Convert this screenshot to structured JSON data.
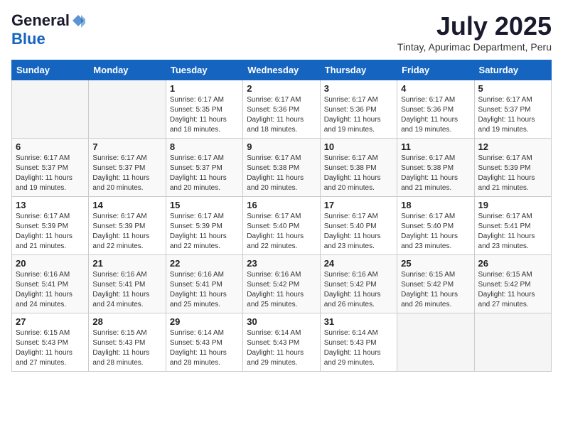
{
  "logo": {
    "general": "General",
    "blue": "Blue"
  },
  "header": {
    "month_year": "July 2025",
    "location": "Tintay, Apurimac Department, Peru"
  },
  "weekdays": [
    "Sunday",
    "Monday",
    "Tuesday",
    "Wednesday",
    "Thursday",
    "Friday",
    "Saturday"
  ],
  "weeks": [
    [
      {
        "day": "",
        "empty": true
      },
      {
        "day": "",
        "empty": true
      },
      {
        "day": "1",
        "sunrise": "Sunrise: 6:17 AM",
        "sunset": "Sunset: 5:35 PM",
        "daylight": "Daylight: 11 hours and 18 minutes."
      },
      {
        "day": "2",
        "sunrise": "Sunrise: 6:17 AM",
        "sunset": "Sunset: 5:36 PM",
        "daylight": "Daylight: 11 hours and 18 minutes."
      },
      {
        "day": "3",
        "sunrise": "Sunrise: 6:17 AM",
        "sunset": "Sunset: 5:36 PM",
        "daylight": "Daylight: 11 hours and 19 minutes."
      },
      {
        "day": "4",
        "sunrise": "Sunrise: 6:17 AM",
        "sunset": "Sunset: 5:36 PM",
        "daylight": "Daylight: 11 hours and 19 minutes."
      },
      {
        "day": "5",
        "sunrise": "Sunrise: 6:17 AM",
        "sunset": "Sunset: 5:37 PM",
        "daylight": "Daylight: 11 hours and 19 minutes."
      }
    ],
    [
      {
        "day": "6",
        "sunrise": "Sunrise: 6:17 AM",
        "sunset": "Sunset: 5:37 PM",
        "daylight": "Daylight: 11 hours and 19 minutes."
      },
      {
        "day": "7",
        "sunrise": "Sunrise: 6:17 AM",
        "sunset": "Sunset: 5:37 PM",
        "daylight": "Daylight: 11 hours and 20 minutes."
      },
      {
        "day": "8",
        "sunrise": "Sunrise: 6:17 AM",
        "sunset": "Sunset: 5:37 PM",
        "daylight": "Daylight: 11 hours and 20 minutes."
      },
      {
        "day": "9",
        "sunrise": "Sunrise: 6:17 AM",
        "sunset": "Sunset: 5:38 PM",
        "daylight": "Daylight: 11 hours and 20 minutes."
      },
      {
        "day": "10",
        "sunrise": "Sunrise: 6:17 AM",
        "sunset": "Sunset: 5:38 PM",
        "daylight": "Daylight: 11 hours and 20 minutes."
      },
      {
        "day": "11",
        "sunrise": "Sunrise: 6:17 AM",
        "sunset": "Sunset: 5:38 PM",
        "daylight": "Daylight: 11 hours and 21 minutes."
      },
      {
        "day": "12",
        "sunrise": "Sunrise: 6:17 AM",
        "sunset": "Sunset: 5:39 PM",
        "daylight": "Daylight: 11 hours and 21 minutes."
      }
    ],
    [
      {
        "day": "13",
        "sunrise": "Sunrise: 6:17 AM",
        "sunset": "Sunset: 5:39 PM",
        "daylight": "Daylight: 11 hours and 21 minutes."
      },
      {
        "day": "14",
        "sunrise": "Sunrise: 6:17 AM",
        "sunset": "Sunset: 5:39 PM",
        "daylight": "Daylight: 11 hours and 22 minutes."
      },
      {
        "day": "15",
        "sunrise": "Sunrise: 6:17 AM",
        "sunset": "Sunset: 5:39 PM",
        "daylight": "Daylight: 11 hours and 22 minutes."
      },
      {
        "day": "16",
        "sunrise": "Sunrise: 6:17 AM",
        "sunset": "Sunset: 5:40 PM",
        "daylight": "Daylight: 11 hours and 22 minutes."
      },
      {
        "day": "17",
        "sunrise": "Sunrise: 6:17 AM",
        "sunset": "Sunset: 5:40 PM",
        "daylight": "Daylight: 11 hours and 23 minutes."
      },
      {
        "day": "18",
        "sunrise": "Sunrise: 6:17 AM",
        "sunset": "Sunset: 5:40 PM",
        "daylight": "Daylight: 11 hours and 23 minutes."
      },
      {
        "day": "19",
        "sunrise": "Sunrise: 6:17 AM",
        "sunset": "Sunset: 5:41 PM",
        "daylight": "Daylight: 11 hours and 23 minutes."
      }
    ],
    [
      {
        "day": "20",
        "sunrise": "Sunrise: 6:16 AM",
        "sunset": "Sunset: 5:41 PM",
        "daylight": "Daylight: 11 hours and 24 minutes."
      },
      {
        "day": "21",
        "sunrise": "Sunrise: 6:16 AM",
        "sunset": "Sunset: 5:41 PM",
        "daylight": "Daylight: 11 hours and 24 minutes."
      },
      {
        "day": "22",
        "sunrise": "Sunrise: 6:16 AM",
        "sunset": "Sunset: 5:41 PM",
        "daylight": "Daylight: 11 hours and 25 minutes."
      },
      {
        "day": "23",
        "sunrise": "Sunrise: 6:16 AM",
        "sunset": "Sunset: 5:42 PM",
        "daylight": "Daylight: 11 hours and 25 minutes."
      },
      {
        "day": "24",
        "sunrise": "Sunrise: 6:16 AM",
        "sunset": "Sunset: 5:42 PM",
        "daylight": "Daylight: 11 hours and 26 minutes."
      },
      {
        "day": "25",
        "sunrise": "Sunrise: 6:15 AM",
        "sunset": "Sunset: 5:42 PM",
        "daylight": "Daylight: 11 hours and 26 minutes."
      },
      {
        "day": "26",
        "sunrise": "Sunrise: 6:15 AM",
        "sunset": "Sunset: 5:42 PM",
        "daylight": "Daylight: 11 hours and 27 minutes."
      }
    ],
    [
      {
        "day": "27",
        "sunrise": "Sunrise: 6:15 AM",
        "sunset": "Sunset: 5:43 PM",
        "daylight": "Daylight: 11 hours and 27 minutes."
      },
      {
        "day": "28",
        "sunrise": "Sunrise: 6:15 AM",
        "sunset": "Sunset: 5:43 PM",
        "daylight": "Daylight: 11 hours and 28 minutes."
      },
      {
        "day": "29",
        "sunrise": "Sunrise: 6:14 AM",
        "sunset": "Sunset: 5:43 PM",
        "daylight": "Daylight: 11 hours and 28 minutes."
      },
      {
        "day": "30",
        "sunrise": "Sunrise: 6:14 AM",
        "sunset": "Sunset: 5:43 PM",
        "daylight": "Daylight: 11 hours and 29 minutes."
      },
      {
        "day": "31",
        "sunrise": "Sunrise: 6:14 AM",
        "sunset": "Sunset: 5:43 PM",
        "daylight": "Daylight: 11 hours and 29 minutes."
      },
      {
        "day": "",
        "empty": true
      },
      {
        "day": "",
        "empty": true
      }
    ]
  ]
}
